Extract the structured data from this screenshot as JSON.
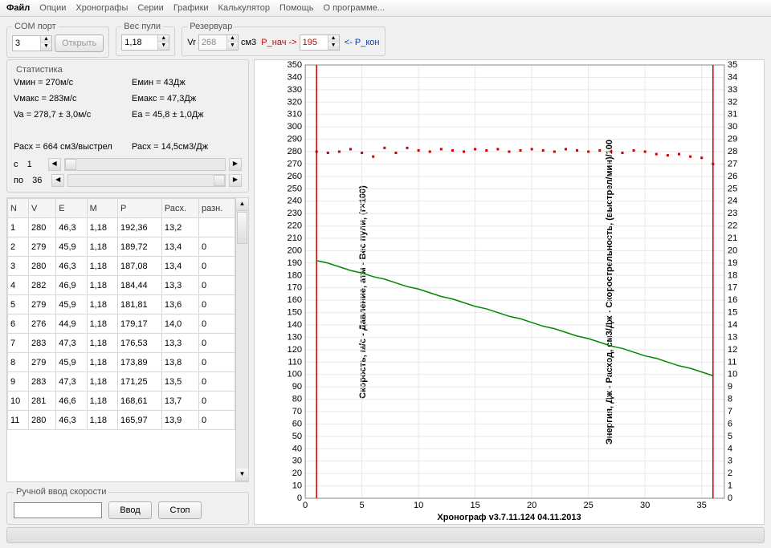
{
  "menu": [
    "Файл",
    "Опции",
    "Хронографы",
    "Серии",
    "Графики",
    "Калькулятор",
    "Помощь",
    "О программе..."
  ],
  "toolbar": {
    "com": {
      "legend": "COM порт",
      "value": "3",
      "open": "Открыть"
    },
    "weight": {
      "legend": "Вес пули",
      "value": "1,18"
    },
    "res": {
      "legend": "Резервуар",
      "vr_label": "Vr",
      "vr": "268",
      "unit": "см3",
      "pstart_label": "P_нач ->",
      "pstart": "195",
      "pend_label": "<- P_кон"
    }
  },
  "stats": {
    "legend": "Статистика",
    "left": [
      "Vмин = 270м/с",
      "Vмакс = 283м/с",
      "Va = 278,7 ± 3,0м/с",
      "",
      "Расх = 664 см3/выстрел"
    ],
    "right": [
      "Eмин = 43Дж",
      "Eмакс = 47,3Дж",
      "Ea = 45,8 ± 1,0Дж",
      "",
      "Расх = 14,5см3/Дж"
    ],
    "from_label": "с",
    "from": "1",
    "to_label": "по",
    "to": "36"
  },
  "table": {
    "headers": [
      "N",
      "V",
      "E",
      "M",
      "P",
      "Расх.",
      "разн."
    ],
    "rows": [
      [
        "1",
        "280",
        "46,3",
        "1,18",
        "192,36",
        "13,2",
        ""
      ],
      [
        "2",
        "279",
        "45,9",
        "1,18",
        "189,72",
        "13,4",
        "0"
      ],
      [
        "3",
        "280",
        "46,3",
        "1,18",
        "187,08",
        "13,4",
        "0"
      ],
      [
        "4",
        "282",
        "46,9",
        "1,18",
        "184,44",
        "13,3",
        "0"
      ],
      [
        "5",
        "279",
        "45,9",
        "1,18",
        "181,81",
        "13,6",
        "0"
      ],
      [
        "6",
        "276",
        "44,9",
        "1,18",
        "179,17",
        "14,0",
        "0"
      ],
      [
        "7",
        "283",
        "47,3",
        "1,18",
        "176,53",
        "13,3",
        "0"
      ],
      [
        "8",
        "279",
        "45,9",
        "1,18",
        "173,89",
        "13,8",
        "0"
      ],
      [
        "9",
        "283",
        "47,3",
        "1,18",
        "171,25",
        "13,5",
        "0"
      ],
      [
        "10",
        "281",
        "46,6",
        "1,18",
        "168,61",
        "13,7",
        "0"
      ],
      [
        "11",
        "280",
        "46,3",
        "1,18",
        "165,97",
        "13,9",
        "0"
      ]
    ]
  },
  "manual": {
    "legend": "Ручной ввод скорости",
    "enter": "Ввод",
    "stop": "Стоп"
  },
  "chart_data": {
    "type": "line",
    "yleft_label": "Скорость, м/с - Давление, атм - Вес пули, (г×100)",
    "yright_label": "Энергия, Дж  -  Расход, см3/Дж - Скорострельность, (выстрел/мин)/100",
    "xtitle": "Хронограф v3.7.11.124     04.11.2013",
    "xlim": [
      0,
      37
    ],
    "xticks": [
      0,
      5,
      10,
      15,
      20,
      25,
      30,
      35
    ],
    "yleft_lim": [
      0,
      350
    ],
    "yleft_ticks": [
      0,
      10,
      20,
      30,
      40,
      50,
      60,
      70,
      80,
      90,
      100,
      110,
      120,
      130,
      140,
      150,
      160,
      170,
      180,
      190,
      200,
      210,
      220,
      230,
      240,
      250,
      260,
      270,
      280,
      290,
      300,
      310,
      320,
      330,
      340,
      350
    ],
    "yright_lim": [
      0,
      35
    ],
    "yright_ticks": [
      0,
      1,
      2,
      3,
      4,
      5,
      6,
      7,
      8,
      9,
      10,
      11,
      12,
      13,
      14,
      15,
      16,
      17,
      18,
      19,
      20,
      21,
      22,
      23,
      24,
      25,
      26,
      27,
      28,
      29,
      30,
      31,
      32,
      33,
      34,
      35
    ],
    "series": [
      {
        "name": "velocity",
        "color": "#d00000",
        "style": "dots",
        "y": [
          280,
          279,
          280,
          282,
          279,
          276,
          283,
          279,
          283,
          281,
          280,
          282,
          281,
          280,
          282,
          281,
          282,
          280,
          281,
          282,
          281,
          280,
          282,
          281,
          280,
          281,
          280,
          279,
          281,
          280,
          278,
          277,
          278,
          276,
          275,
          270
        ],
        "x_start": 1
      },
      {
        "name": "pressure",
        "color": "#008800",
        "style": "line",
        "y": [
          192,
          190,
          187,
          184,
          182,
          179,
          177,
          174,
          171,
          169,
          166,
          163,
          161,
          158,
          155,
          153,
          150,
          147,
          145,
          142,
          139,
          137,
          134,
          131,
          129,
          126,
          123,
          121,
          118,
          115,
          113,
          110,
          107,
          105,
          102,
          99
        ],
        "x_start": 1
      }
    ],
    "vlines": [
      1,
      36
    ]
  }
}
